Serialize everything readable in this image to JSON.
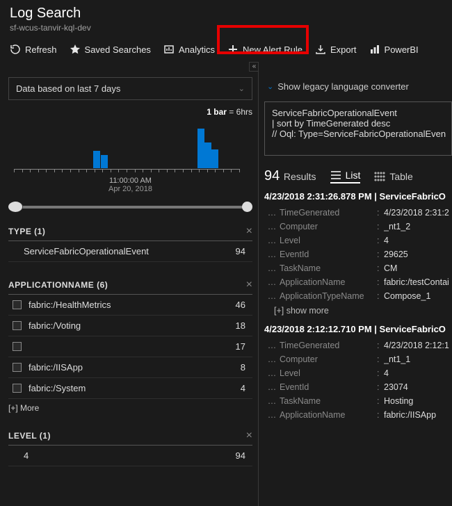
{
  "header": {
    "title": "Log Search",
    "subtitle": "sf-wcus-tanvir-kql-dev"
  },
  "toolbar": {
    "refresh": "Refresh",
    "saved": "Saved Searches",
    "analytics": "Analytics",
    "newAlert": "New Alert Rule",
    "export": "Export",
    "powerbi": "PowerBI"
  },
  "left": {
    "timeRange": "Data based on last 7 days",
    "barLegendBold": "1 bar",
    "barLegendRest": " = 6hrs",
    "axisTime": "11:00:00 AM",
    "axisDate": "Apr 20, 2018",
    "facets": {
      "type": {
        "title": "TYPE  (1)",
        "rows": [
          {
            "label": "ServiceFabricOperationalEvent",
            "count": "94"
          }
        ]
      },
      "appname": {
        "title": "APPLICATIONNAME  (6)",
        "rows": [
          {
            "label": "fabric:/HealthMetrics",
            "count": "46"
          },
          {
            "label": "fabric:/Voting",
            "count": "18"
          },
          {
            "label": "",
            "count": "17"
          },
          {
            "label": "fabric:/IISApp",
            "count": "8"
          },
          {
            "label": "fabric:/System",
            "count": "4"
          }
        ],
        "more": "[+] More"
      },
      "level": {
        "title": "LEVEL  (1)",
        "rows": [
          {
            "label": "4",
            "count": "94"
          }
        ]
      }
    }
  },
  "right": {
    "legacyLink": "Show legacy language converter",
    "query": "ServiceFabricOperationalEvent\n| sort by TimeGenerated desc\n// Oql: Type=ServiceFabricOperationalEven",
    "resultCount": "94",
    "resultLabel": "Results",
    "views": {
      "list": "List",
      "table": "Table"
    },
    "records": [
      {
        "header": "4/23/2018 2:31:26.878 PM | ServiceFabricO",
        "fields": [
          {
            "k": "TimeGenerated",
            "v": "4/23/2018 2:31:2"
          },
          {
            "k": "Computer",
            "v": "_nt1_2"
          },
          {
            "k": "Level",
            "v": "4"
          },
          {
            "k": "EventId",
            "v": "29625"
          },
          {
            "k": "TaskName",
            "v": "CM"
          },
          {
            "k": "ApplicationName",
            "v": "fabric:/testContai"
          },
          {
            "k": "ApplicationTypeName",
            "v": "Compose_1"
          }
        ],
        "showMore": "[+] show more"
      },
      {
        "header": "4/23/2018 2:12:12.710 PM | ServiceFabricO",
        "fields": [
          {
            "k": "TimeGenerated",
            "v": "4/23/2018 2:12:1"
          },
          {
            "k": "Computer",
            "v": "_nt1_1"
          },
          {
            "k": "Level",
            "v": "4"
          },
          {
            "k": "EventId",
            "v": "23074"
          },
          {
            "k": "TaskName",
            "v": "Hosting"
          },
          {
            "k": "ApplicationName",
            "v": "fabric:/IISApp"
          }
        ]
      }
    ]
  },
  "chart_data": {
    "type": "bar",
    "title": "",
    "xlabel": "",
    "ylabel": "",
    "ylim": [
      0,
      60
    ],
    "bar_legend": "1 bar = 6hrs",
    "axis_center_time": "11:00:00 AM",
    "axis_center_date": "Apr 20, 2018",
    "bars": [
      {
        "position_pct": 36,
        "value": 24
      },
      {
        "position_pct": 39,
        "value": 18
      },
      {
        "position_pct": 80,
        "value": 55
      },
      {
        "position_pct": 83,
        "value": 36
      },
      {
        "position_pct": 86,
        "value": 26
      }
    ]
  }
}
